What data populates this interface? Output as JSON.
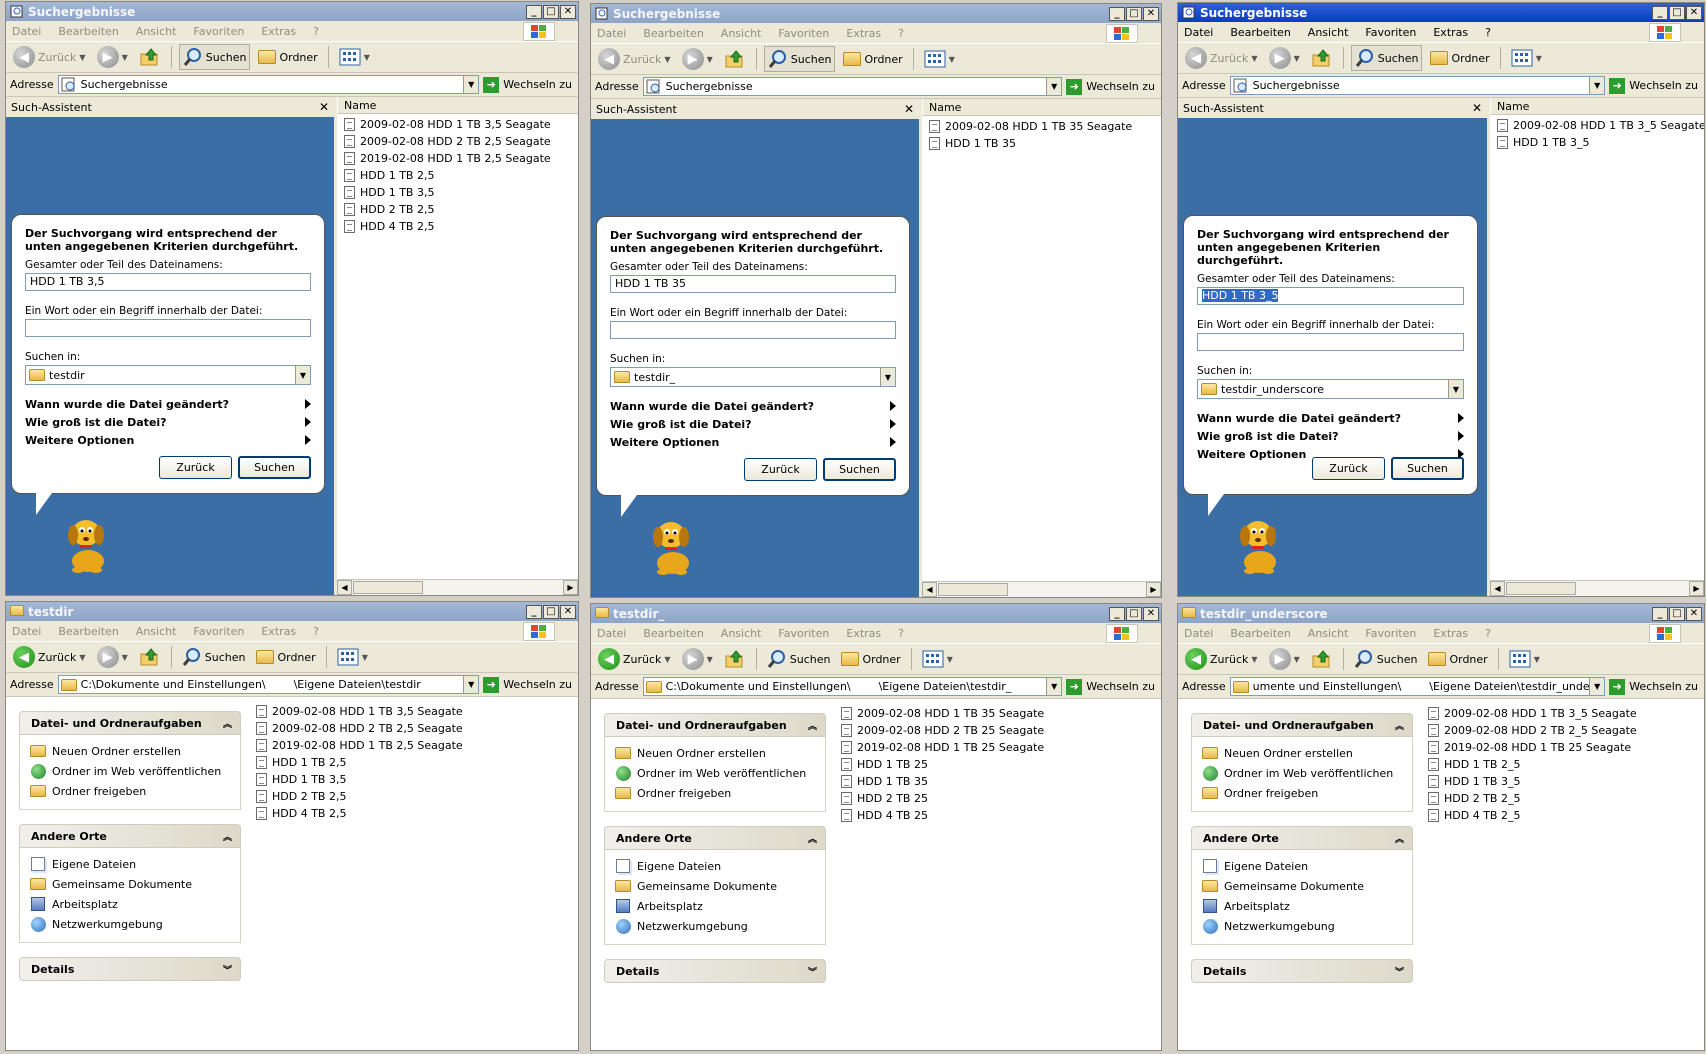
{
  "menu": [
    "Datei",
    "Bearbeiten",
    "Ansicht",
    "Favoriten",
    "Extras",
    "?"
  ],
  "toolbar": {
    "back": "Zurück",
    "search": "Suchen",
    "folders": "Ordner"
  },
  "address_label": "Adresse",
  "go_label": "Wechseln zu",
  "search_windows": [
    {
      "title": "Suchergebnisse",
      "address": "Suchergebnisse",
      "assistant_title": "Such-Assistent",
      "intro": "Der Suchvorgang wird entsprechend der unten angegebenen Kriterien durchgeführt.",
      "name_label": "Gesamter oder Teil des Dateinamens:",
      "name_value": "HDD 1 TB 3,5",
      "word_label": "Ein Wort oder ein Begriff innerhalb der Datei:",
      "word_value": "",
      "lookin_label": "Suchen in:",
      "lookin_value": "testdir",
      "opt_when": "Wann wurde die Datei geändert?",
      "opt_size": "Wie groß ist die Datei?",
      "opt_more": "Weitere Optionen",
      "btn_back": "Zurück",
      "btn_search": "Suchen",
      "col_name": "Name",
      "results": [
        "2009-02-08 HDD 1 TB 3,5 Seagate",
        "2009-02-08 HDD 2 TB 2,5 Seagate",
        "2019-02-08 HDD 1 TB 2,5 Seagate",
        "HDD 1 TB 2,5",
        "HDD 1 TB 3,5",
        "HDD 2 TB 2,5",
        "HDD 4 TB 2,5"
      ]
    },
    {
      "title": "Suchergebnisse",
      "address": "Suchergebnisse",
      "assistant_title": "Such-Assistent",
      "intro": "Der Suchvorgang wird entsprechend der unten angegebenen Kriterien durchgeführt.",
      "name_label": "Gesamter oder Teil des Dateinamens:",
      "name_value": "HDD 1 TB 35",
      "word_label": "Ein Wort oder ein Begriff innerhalb der Datei:",
      "word_value": "",
      "lookin_label": "Suchen in:",
      "lookin_value": "testdir_",
      "opt_when": "Wann wurde die Datei geändert?",
      "opt_size": "Wie groß ist die Datei?",
      "opt_more": "Weitere Optionen",
      "btn_back": "Zurück",
      "btn_search": "Suchen",
      "col_name": "Name",
      "results": [
        "2009-02-08 HDD 1 TB 35 Seagate",
        "HDD 1 TB 35"
      ]
    },
    {
      "title": "Suchergebnisse",
      "address": "Suchergebnisse",
      "assistant_title": "Such-Assistent",
      "intro": "Der Suchvorgang wird entsprechend der unten angegebenen Kriterien durchgeführt.",
      "name_label": "Gesamter oder Teil des Dateinamens:",
      "name_value": "HDD 1 TB 3_5",
      "word_label": "Ein Wort oder ein Begriff innerhalb der Datei:",
      "word_value": "",
      "lookin_label": "Suchen in:",
      "lookin_value": "testdir_underscore",
      "opt_when": "Wann wurde die Datei geändert?",
      "opt_size": "Wie groß ist die Datei?",
      "opt_more": "Weitere Optionen",
      "btn_back": "Zurück",
      "btn_search": "Suchen",
      "col_name": "Name",
      "results": [
        "2009-02-08 HDD 1 TB 3_5 Seagate",
        "HDD 1 TB 3_5"
      ]
    }
  ],
  "folder_windows": [
    {
      "title": "testdir",
      "address": "C:\\Dokumente und Einstellungen\\        \\Eigene Dateien\\testdir",
      "files": [
        "2009-02-08 HDD 1 TB 3,5 Seagate",
        "2009-02-08 HDD 2 TB 2,5 Seagate",
        "2019-02-08 HDD 1 TB 2,5 Seagate",
        "HDD 1 TB 2,5",
        "HDD 1 TB 3,5",
        "HDD 2 TB 2,5",
        "HDD 4 TB 2,5"
      ]
    },
    {
      "title": "testdir_",
      "address": "C:\\Dokumente und Einstellungen\\        \\Eigene Dateien\\testdir_",
      "files": [
        "2009-02-08 HDD 1 TB 35 Seagate",
        "2009-02-08 HDD 2 TB 25 Seagate",
        "2019-02-08 HDD 1 TB 25 Seagate",
        "HDD 1 TB 25",
        "HDD 1 TB 35",
        "HDD 2 TB 25",
        "HDD 4 TB 25"
      ]
    },
    {
      "title": "testdir_underscore",
      "address": "umente und Einstellungen\\        \\Eigene Dateien\\testdir_underscore",
      "files": [
        "2009-02-08 HDD 1 TB 3_5 Seagate",
        "2009-02-08 HDD 2 TB 2_5 Seagate",
        "2019-02-08 HDD 1 TB 25 Seagate",
        "HDD 1 TB 2_5",
        "HDD 1 TB 3_5",
        "HDD 2 TB 2_5",
        "HDD 4 TB 2_5"
      ]
    }
  ],
  "tasks": {
    "panel1_title": "Datei- und Ordneraufgaben",
    "panel1_items": [
      "Neuen Ordner erstellen",
      "Ordner im Web veröffentlichen",
      "Ordner freigeben"
    ],
    "panel2_title": "Andere Orte",
    "panel2_items": [
      "Eigene Dateien",
      "Gemeinsame Dokumente",
      "Arbeitsplatz",
      "Netzwerkumgebung"
    ],
    "panel3_title": "Details"
  }
}
